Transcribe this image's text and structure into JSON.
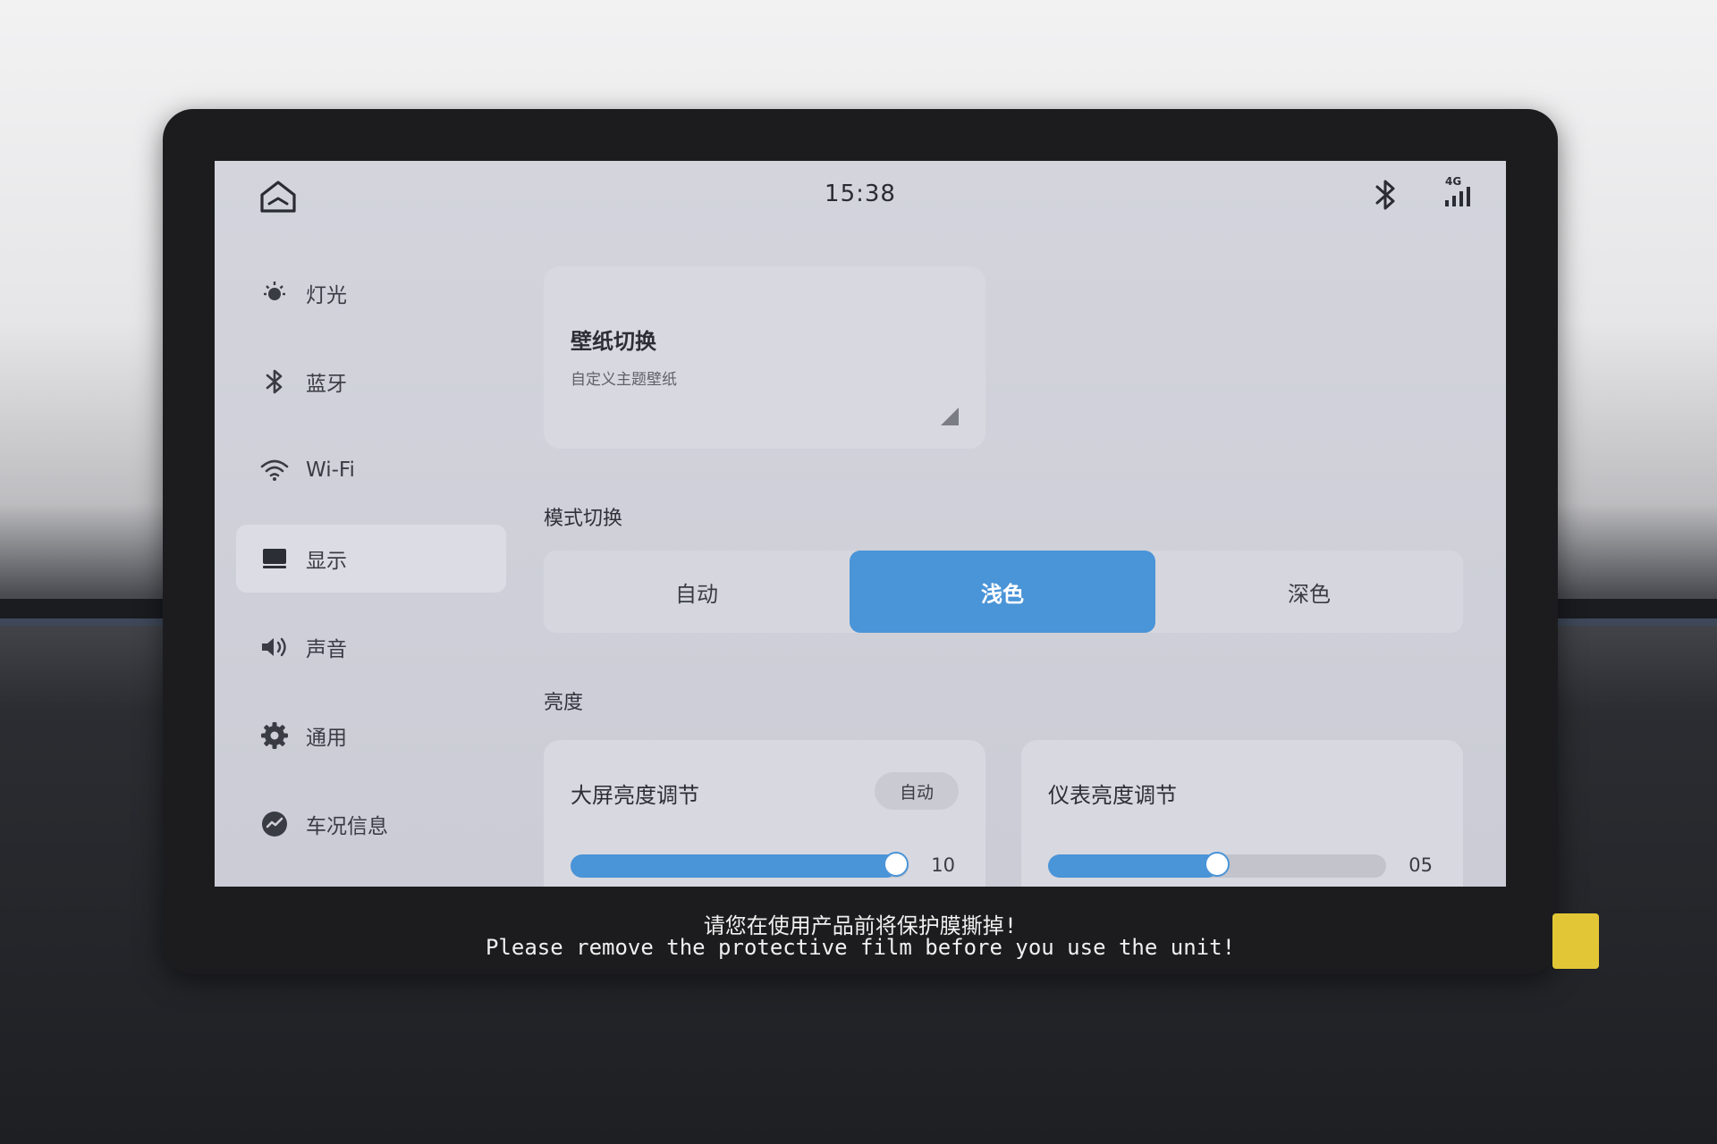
{
  "status_bar": {
    "time": "15:38",
    "network": "4G"
  },
  "sidebar": {
    "items": [
      {
        "label": "灯光",
        "icon": "light-icon",
        "active": false
      },
      {
        "label": "蓝牙",
        "icon": "bluetooth-icon",
        "active": false
      },
      {
        "label": "Wi-Fi",
        "icon": "wifi-icon",
        "active": false
      },
      {
        "label": "显示",
        "icon": "display-icon",
        "active": true
      },
      {
        "label": "声音",
        "icon": "speaker-icon",
        "active": false
      },
      {
        "label": "通用",
        "icon": "gear-icon",
        "active": false
      },
      {
        "label": "车况信息",
        "icon": "vehicle-status-icon",
        "active": false
      }
    ]
  },
  "wallpaper": {
    "title": "壁纸切换",
    "subtitle": "自定义主题壁纸"
  },
  "mode": {
    "title": "模式切换",
    "options": [
      "自动",
      "浅色",
      "深色"
    ],
    "selected": "浅色"
  },
  "brightness": {
    "title": "亮度",
    "screen": {
      "title": "大屏亮度调节",
      "auto_label": "自动",
      "value": "10",
      "level": 1.0
    },
    "cluster": {
      "title": "仪表亮度调节",
      "value": "05",
      "level": 0.5
    }
  },
  "film_notice": {
    "zh": "请您在使用产品前将保护膜撕掉!",
    "en": "Please remove the protective film before you use the unit!"
  },
  "colors": {
    "accent": "#4a94d8",
    "screen_bg": "#cfd0d8"
  }
}
